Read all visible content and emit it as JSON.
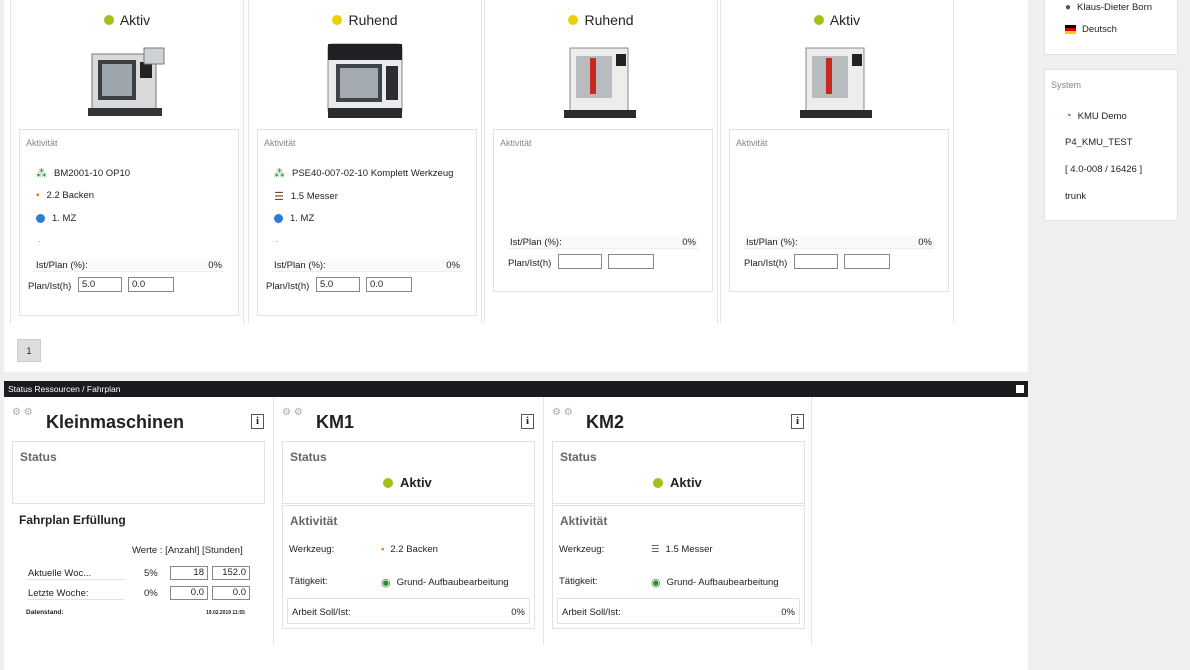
{
  "machines": [
    {
      "status": "Aktiv",
      "status_color": "#9dc21a",
      "activity_title": "Aktivität",
      "job": "BM2001-10 OP10",
      "tool": "2.2 Backen",
      "mz": "1. MZ",
      "dot_line": ".",
      "ist_plan_label": "Ist/Plan (%):",
      "ist_plan_value": "0%",
      "plan_ist_label": "Plan/Ist(h)",
      "plan_value": "5.0",
      "ist_value": "0.0"
    },
    {
      "status": "Ruhend",
      "status_color": "#e6d200",
      "activity_title": "Aktivität",
      "job": "PSE40-007-02-10 Komplett Werkzeug",
      "tool": "1.5 Messer",
      "mz": "1. MZ",
      "dot_line": ".",
      "ist_plan_label": "Ist/Plan (%):",
      "ist_plan_value": "0%",
      "plan_ist_label": "Plan/Ist(h)",
      "plan_value": "5.0",
      "ist_value": "0.0"
    },
    {
      "status": "Ruhend",
      "status_color": "#e6d200",
      "activity_title": "Aktivität",
      "ist_plan_label": "Ist/Plan (%):",
      "ist_plan_value": "0%",
      "plan_ist_label": "Plan/Ist(h)",
      "plan_value": "",
      "ist_value": ""
    },
    {
      "status": "Aktiv",
      "status_color": "#9dc21a",
      "activity_title": "Aktivität",
      "ist_plan_label": "Ist/Plan (%):",
      "ist_plan_value": "0%",
      "plan_ist_label": "Plan/Ist(h)",
      "plan_value": "",
      "ist_value": ""
    }
  ],
  "pager": {
    "page": "1"
  },
  "user_panel": {
    "user_name": "Klaus-Dieter Born",
    "language": "Deutsch"
  },
  "system_panel": {
    "title": "System",
    "app": "KMU Demo",
    "db": "P4_KMU_TEST",
    "version": "[ 4.0-008 / 16426 ]",
    "branch": "trunk"
  },
  "status_bar": {
    "title": "Status Ressourcen / Fahrplan"
  },
  "kleinmaschinen": {
    "title": "Kleinmaschinen",
    "info": "i",
    "status_label": "Status",
    "fahrplan_title": "Fahrplan Erfüllung",
    "werte_label": "Werte : [Anzahl] [Stunden]",
    "rows": [
      {
        "label": "Aktuelle Woc...",
        "pct": "5%",
        "anzahl": "18",
        "stunden": "152.0"
      },
      {
        "label": "Letzte Woche:",
        "pct": "0%",
        "anzahl": "0.0",
        "stunden": "0.0"
      }
    ],
    "datenstand_label": "Datenstand:",
    "datenstand_value": "19.02.2019 11:55"
  },
  "km_panels": [
    {
      "title": "KM1",
      "info": "i",
      "status_label": "Status",
      "status": "Aktiv",
      "status_color": "#9dc21a",
      "activity_label": "Aktivität",
      "werkzeug_label": "Werkzeug:",
      "werkzeug": "2.2 Backen",
      "taetigkeit_label": "Tätigkeit:",
      "taetigkeit": "Grund- Aufbaubearbeitung",
      "arbeit_label": "Arbeit Soll/Ist:",
      "arbeit_value": "0%"
    },
    {
      "title": "KM2",
      "info": "i",
      "status_label": "Status",
      "status": "Aktiv",
      "status_color": "#9dc21a",
      "activity_label": "Aktivität",
      "werkzeug_label": "Werkzeug:",
      "werkzeug": "1.5 Messer",
      "taetigkeit_label": "Tätigkeit:",
      "taetigkeit": "Grund- Aufbaubearbeitung",
      "arbeit_label": "Arbeit Soll/Ist:",
      "arbeit_value": "0%"
    }
  ]
}
